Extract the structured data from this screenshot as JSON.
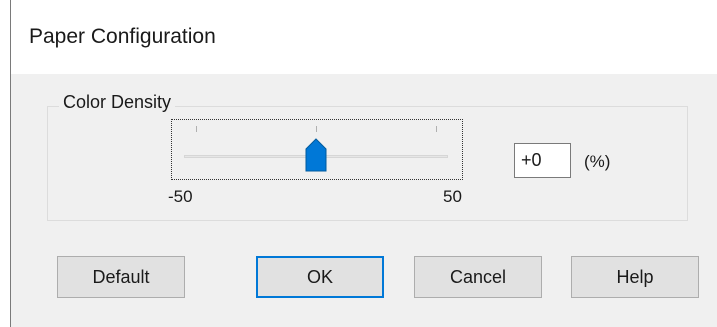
{
  "window": {
    "title": "Paper Configuration"
  },
  "color_density": {
    "group_label": "Color Density",
    "min_label": "-50",
    "max_label": "50",
    "min": -50,
    "max": 50,
    "value": 0,
    "value_text": "+0",
    "unit_label": "(%)"
  },
  "buttons": {
    "default_label": "Default",
    "ok_label": "OK",
    "cancel_label": "Cancel",
    "help_label": "Help"
  },
  "colors": {
    "accent": "#0078d7",
    "thumb": "#0078d7"
  },
  "icons": {
    "slider_thumb": "slider-thumb-icon"
  }
}
